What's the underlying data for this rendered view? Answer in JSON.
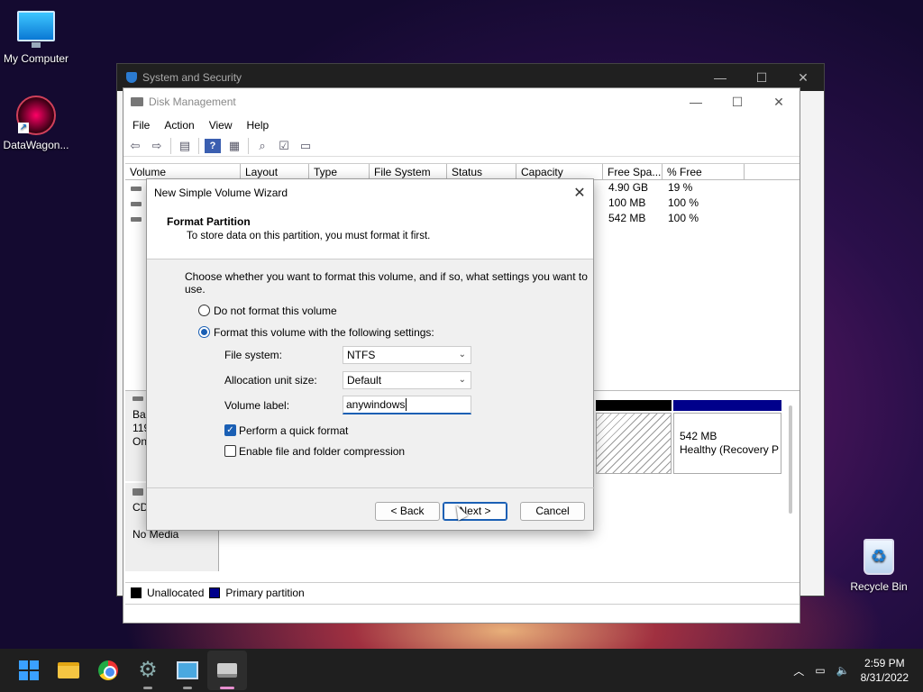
{
  "desktop": {
    "icons": [
      {
        "label": "My Computer"
      },
      {
        "label": "DataWagon..."
      },
      {
        "label": "Recycle Bin"
      }
    ]
  },
  "back_window": {
    "title": "System and Security"
  },
  "disk_mgmt": {
    "title": "Disk Management",
    "menu": [
      "File",
      "Action",
      "View",
      "Help"
    ],
    "columns": [
      "Volume",
      "Layout",
      "Type",
      "File System",
      "Status",
      "Capacity",
      "Free Spa...",
      "% Free"
    ],
    "rows": [
      {
        "free": "4.90 GB",
        "pct": "19 %"
      },
      {
        "free": "100 MB",
        "pct": "100 %"
      },
      {
        "free": "542 MB",
        "pct": "100 %"
      }
    ],
    "disk0": {
      "l1": "Bas",
      "l2": "119",
      "l3": "On"
    },
    "cdrom": {
      "l1": "CD",
      "l2": "No Media"
    },
    "recovery": {
      "size": "542 MB",
      "status": "Healthy (Recovery P"
    },
    "legend": {
      "unallocated": "Unallocated",
      "primary": "Primary partition"
    },
    "colors": {
      "primary": "#00008b",
      "unallocated": "#000000"
    }
  },
  "wizard": {
    "title": "New Simple Volume Wizard",
    "header_title": "Format Partition",
    "header_sub": "To store data on this partition, you must format it first.",
    "instruction": "Choose whether you want to format this volume, and if so, what settings you want to use.",
    "opt_no_format": "Do not format this volume",
    "opt_format": "Format this volume with the following settings:",
    "fs_label": "File system:",
    "fs_value": "NTFS",
    "alloc_label": "Allocation unit size:",
    "alloc_value": "Default",
    "vol_label": "Volume label:",
    "vol_value": "anywindows",
    "quick_format": "Perform a quick format",
    "compression": "Enable file and folder compression",
    "back": "< Back",
    "next": "Next >",
    "cancel": "Cancel"
  },
  "taskbar": {
    "time": "2:59 PM",
    "date": "8/31/2022"
  }
}
